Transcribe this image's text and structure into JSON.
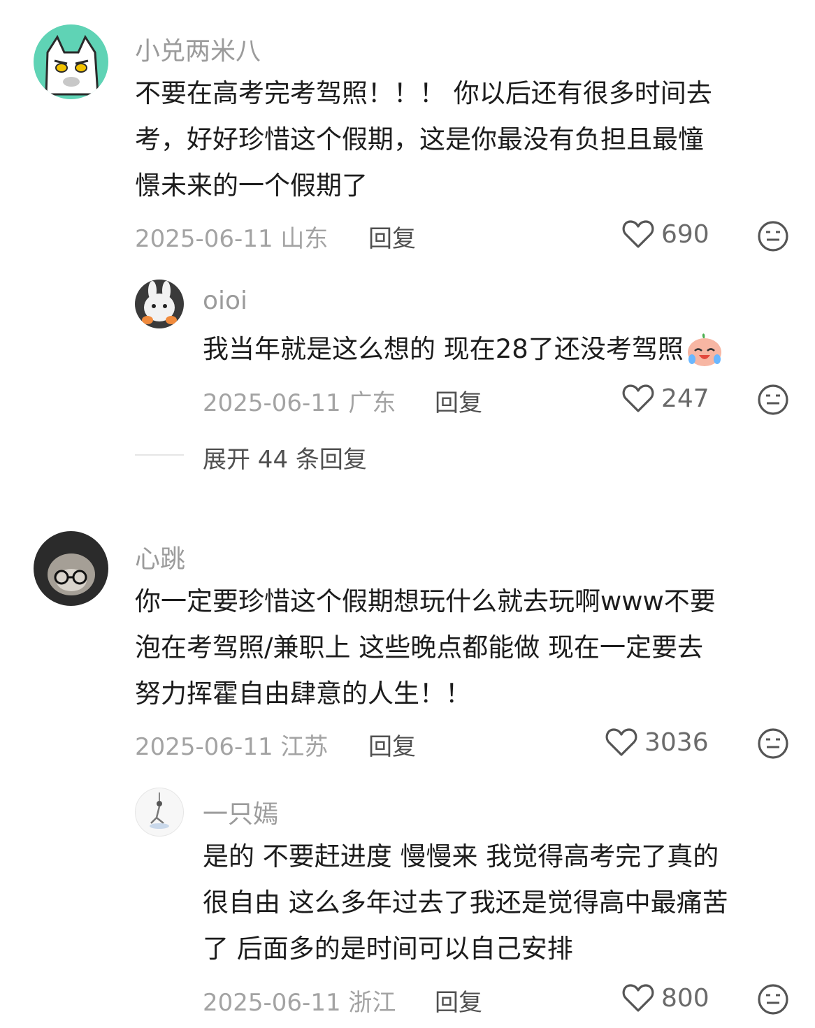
{
  "comments": [
    {
      "user": "小兑两米八",
      "text": "不要在高考完考驾照！！！ 你以后还有很多时间去\n考，好好珍惜这个假期，这是你最没有负担且最憧\n憬未来的一个假期了",
      "date": "2025-06-11",
      "location": "山东",
      "reply_label": "回复",
      "likes": "690"
    },
    {
      "user": "oioi",
      "text": "我当年就是这么想的 现在28了还没考驾照",
      "date": "2025-06-11",
      "location": "广东",
      "reply_label": "回复",
      "likes": "247"
    },
    {
      "user": "心跳",
      "text": "你一定要珍惜这个假期想玩什么就去玩啊www不要\n泡在考驾照/兼职上 这些晚点都能做 现在一定要去\n努力挥霍自由肆意的人生！！",
      "date": "2025-06-11",
      "location": "江苏",
      "reply_label": "回复",
      "likes": "3036"
    },
    {
      "user": "一只嫣",
      "text": "是的 不要赶进度 慢慢来 我觉得高考完了真的\n很自由 这么多年过去了我还是觉得高中最痛苦\n了 后面多的是时间可以自己安排",
      "date": "2025-06-11",
      "location": "浙江",
      "reply_label": "回复",
      "likes": "800"
    }
  ],
  "expand_replies": "展开 44 条回复",
  "icons": {
    "like": "heart-outline-icon",
    "dislike": "meh-face-icon",
    "emoji": "crying-laughing-emoji"
  }
}
